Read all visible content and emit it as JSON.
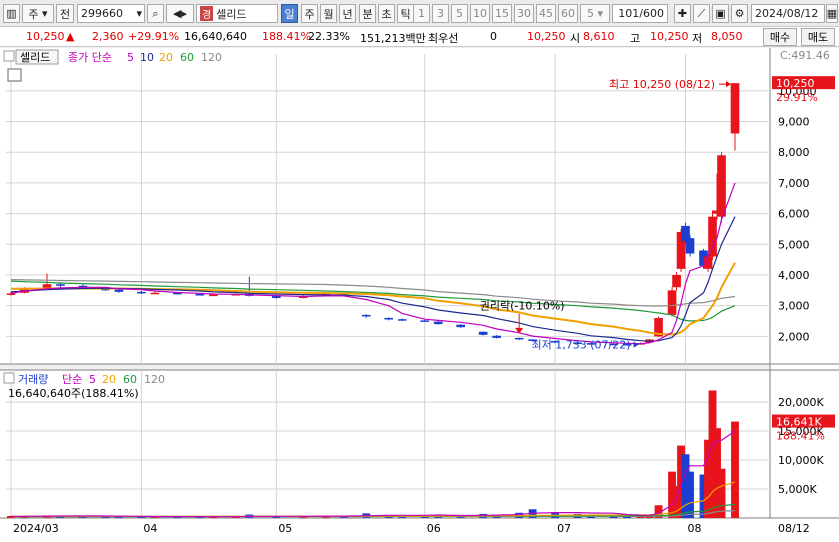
{
  "toolbar": {
    "market": "주",
    "all": "전",
    "code": "299660",
    "name_badge": "경",
    "name": "셀리드",
    "periods": [
      "일",
      "주",
      "월",
      "년",
      "분",
      "초",
      "틱"
    ],
    "minutes": [
      "1",
      "3",
      "5",
      "10",
      "15",
      "30",
      "45",
      "60"
    ],
    "interval": "5",
    "count": "101/600",
    "date": "2024/08/12"
  },
  "quote": {
    "price": "10,250",
    "change": "2,360",
    "change_pct": "+29.91%",
    "volume": "16,640,640",
    "volume_pct": "188.41%",
    "turnover": "22.33%",
    "amount": "151,213백만",
    "best_bid_label": "최우선",
    "best_bid": "0",
    "best_ask": "10,250",
    "open_label": "시",
    "open": "8,610",
    "high_label": "고",
    "high": "10,250",
    "low_label": "저",
    "low": "8,050",
    "buy": "매수",
    "sell": "매도"
  },
  "colors": {
    "up": "#e8141c",
    "down": "#1b3fd0",
    "ma5": "#c000c0",
    "ma10": "#1e2a8c",
    "ma20": "#f2a000",
    "ma60": "#1e9a3a",
    "ma120": "#8a8a8a"
  },
  "chart_data": [
    {
      "type": "candlestick",
      "panel_label": "셀리드",
      "indicator_label": "종가 단순",
      "ma_periods": [
        "5",
        "10",
        "20",
        "60",
        "120"
      ],
      "x_dates": [
        "2024/03/04",
        "2024/03/07",
        "2024/03/12",
        "2024/03/15",
        "2024/03/20",
        "2024/03/25",
        "2024/03/28",
        "2024/04/02",
        "2024/04/05",
        "2024/04/10",
        "2024/04/15",
        "2024/04/18",
        "2024/04/23",
        "2024/04/26",
        "2024/05/02",
        "2024/05/08",
        "2024/05/13",
        "2024/05/17",
        "2024/05/22",
        "2024/05/27",
        "2024/05/30",
        "2024/06/04",
        "2024/06/07",
        "2024/06/12",
        "2024/06/17",
        "2024/06/20",
        "2024/06/25",
        "2024/06/28",
        "2024/07/03",
        "2024/07/08",
        "2024/07/11",
        "2024/07/16",
        "2024/07/19",
        "2024/07/22",
        "2024/07/24",
        "2024/07/26",
        "2024/07/29",
        "2024/07/30",
        "2024/07/31",
        "2024/08/01",
        "2024/08/02",
        "2024/08/05",
        "2024/08/06",
        "2024/08/07",
        "2024/08/08",
        "2024/08/09",
        "2024/08/12"
      ],
      "close": [
        3400,
        3550,
        3700,
        3650,
        3600,
        3500,
        3450,
        3400,
        3420,
        3380,
        3350,
        3360,
        3380,
        3320,
        3250,
        3300,
        3400,
        3350,
        2650,
        2550,
        2520,
        2500,
        2400,
        2300,
        2050,
        1950,
        1900,
        1850,
        1800,
        1780,
        1760,
        1750,
        1740,
        1780,
        1900,
        2600,
        3500,
        4000,
        5400,
        5100,
        4700,
        4300,
        4600,
        5900,
        6100,
        7900,
        10250
      ],
      "open": [
        3350,
        3420,
        3580,
        3700,
        3650,
        3600,
        3520,
        3450,
        3400,
        3420,
        3380,
        3340,
        3360,
        3380,
        3320,
        3250,
        3320,
        3400,
        2700,
        2600,
        2560,
        2520,
        2480,
        2380,
        2150,
        2020,
        1950,
        1900,
        1850,
        1800,
        1780,
        1760,
        1750,
        1740,
        1800,
        2000,
        2700,
        3600,
        4200,
        5600,
        5200,
        4800,
        4200,
        4600,
        6000,
        5900,
        8610
      ],
      "high": [
        3450,
        3600,
        4050,
        3750,
        3700,
        3620,
        3550,
        3480,
        3460,
        3440,
        3400,
        3380,
        3400,
        3950,
        3340,
        3340,
        3430,
        3420,
        2720,
        2620,
        2580,
        2540,
        2500,
        2400,
        2160,
        2040,
        1960,
        1910,
        1860,
        1820,
        1800,
        1780,
        1770,
        1800,
        1920,
        2650,
        3600,
        4100,
        5500,
        5700,
        5300,
        4850,
        4700,
        6100,
        7300,
        8000,
        10250
      ],
      "low": [
        3330,
        3400,
        3550,
        3600,
        3580,
        3480,
        3420,
        3380,
        3380,
        3360,
        3330,
        3330,
        3340,
        3300,
        3230,
        3240,
        3300,
        3330,
        2600,
        2520,
        2500,
        2480,
        2380,
        2280,
        2030,
        1930,
        1880,
        1830,
        1780,
        1760,
        1740,
        1733,
        1735,
        1735,
        1780,
        1980,
        2650,
        3500,
        4100,
        5000,
        4600,
        4200,
        4100,
        4500,
        5800,
        5700,
        8050
      ],
      "ma5": [
        3400,
        3480,
        3550,
        3580,
        3600,
        3600,
        3550,
        3520,
        3480,
        3430,
        3400,
        3380,
        3370,
        3350,
        3330,
        3300,
        3320,
        3320,
        3200,
        3000,
        2750,
        2560,
        2520,
        2460,
        2360,
        2240,
        2120,
        2010,
        1930,
        1860,
        1820,
        1790,
        1770,
        1760,
        1790,
        1890,
        2130,
        2520,
        3080,
        3720,
        4140,
        4300,
        4620,
        4900,
        5200,
        5800,
        7000
      ],
      "ma10": [
        3450,
        3480,
        3520,
        3540,
        3560,
        3570,
        3560,
        3550,
        3530,
        3510,
        3480,
        3450,
        3430,
        3400,
        3380,
        3360,
        3350,
        3340,
        3300,
        3200,
        3080,
        2960,
        2860,
        2760,
        2680,
        2580,
        2440,
        2320,
        2200,
        2100,
        2020,
        1960,
        1900,
        1860,
        1840,
        1860,
        1960,
        2100,
        2340,
        2700,
        3100,
        3420,
        3760,
        4200,
        4600,
        5000,
        5900
      ],
      "ma20": [
        3550,
        3550,
        3560,
        3560,
        3560,
        3560,
        3560,
        3550,
        3540,
        3530,
        3520,
        3500,
        3480,
        3460,
        3440,
        3420,
        3410,
        3400,
        3380,
        3340,
        3300,
        3240,
        3160,
        3080,
        2980,
        2880,
        2780,
        2680,
        2580,
        2480,
        2400,
        2320,
        2240,
        2180,
        2120,
        2080,
        2060,
        2080,
        2140,
        2240,
        2400,
        2600,
        2800,
        3000,
        3250,
        3600,
        4400
      ],
      "ma60": [
        3800,
        3780,
        3760,
        3740,
        3720,
        3700,
        3680,
        3660,
        3640,
        3620,
        3600,
        3580,
        3560,
        3540,
        3520,
        3500,
        3480,
        3460,
        3430,
        3400,
        3360,
        3320,
        3280,
        3240,
        3200,
        3160,
        3120,
        3080,
        3040,
        3000,
        2960,
        2920,
        2880,
        2840,
        2800,
        2760,
        2700,
        2620,
        2560,
        2520,
        2500,
        2520,
        2560,
        2620,
        2720,
        2820,
        3000
      ],
      "ma120": [
        3850,
        3840,
        3830,
        3820,
        3810,
        3800,
        3790,
        3780,
        3770,
        3760,
        3750,
        3740,
        3730,
        3720,
        3710,
        3700,
        3690,
        3670,
        3640,
        3600,
        3560,
        3510,
        3460,
        3410,
        3360,
        3310,
        3260,
        3210,
        3160,
        3120,
        3080,
        3050,
        3020,
        3000,
        2990,
        2990,
        3000,
        3020,
        3040,
        3060,
        3080,
        3100,
        3130,
        3160,
        3200,
        3240,
        3300
      ],
      "y_ticks": [
        2000,
        3000,
        4000,
        5000,
        6000,
        7000,
        8000,
        9000,
        10000
      ],
      "y_tick_labels": [
        "2,000",
        "3,000",
        "4,000",
        "5,000",
        "6,000",
        "7,000",
        "8,000",
        "9,000",
        "10,000"
      ],
      "ylim": [
        1100,
        11200
      ],
      "x_tick_labels": [
        {
          "date": "2024/03/04",
          "label": "2024/03"
        },
        {
          "date": "2024/04/02",
          "label": "04"
        },
        {
          "date": "2024/05/02",
          "label": "05"
        },
        {
          "date": "2024/06/04",
          "label": "06"
        },
        {
          "date": "2024/07/03",
          "label": "07"
        },
        {
          "date": "2024/08/01",
          "label": "08"
        },
        {
          "date": "2024/08/12",
          "label": "08/12"
        }
      ],
      "price_tag": "10,250",
      "price_tag_pct": "29.91%",
      "top_label": "C:491.46",
      "annotations": [
        {
          "date": "2024/08/12",
          "value": 10250,
          "text": "최고 10,250 (08/12)",
          "color": "#e00000"
        },
        {
          "date": "2024/07/22",
          "value": 1733,
          "text": "최저 1,733 (07/22)",
          "color": "#1b3fd0"
        },
        {
          "date": "2024/06/25",
          "value": 3000,
          "text": "권리락(-10.10%)",
          "color": "#000000"
        }
      ]
    },
    {
      "type": "bar",
      "panel_label": "거래량",
      "indicator_label": "단순",
      "ma_periods": [
        "5",
        "20",
        "60",
        "120"
      ],
      "volume_readout": "16,640,640주(188.41%)",
      "values": [
        350000,
        300000,
        450000,
        420000,
        300000,
        250000,
        260000,
        240000,
        220000,
        230000,
        210000,
        200000,
        220000,
        600000,
        250000,
        230000,
        280000,
        300000,
        800000,
        500000,
        450000,
        420000,
        380000,
        400000,
        700000,
        600000,
        900000,
        1500000,
        1000000,
        700000,
        500000,
        450000,
        400000,
        380000,
        600000,
        2200000,
        8000000,
        5500000,
        12500000,
        11000000,
        8000000,
        7500000,
        13500000,
        22000000,
        15500000,
        8500000,
        16640640
      ],
      "vol_ma5": [
        300000,
        300000,
        320000,
        340000,
        360000,
        340000,
        330000,
        300000,
        260000,
        240000,
        230000,
        220000,
        220000,
        300000,
        300000,
        300000,
        320000,
        330000,
        400000,
        450000,
        460000,
        470000,
        510000,
        430000,
        470000,
        500000,
        600000,
        820000,
        940000,
        940000,
        860000,
        820000,
        610000,
        490000,
        470000,
        800000,
        2300000,
        3400000,
        5800000,
        7800000,
        9000000,
        9000000,
        10500000,
        12500000,
        13300000,
        13400000,
        15000000
      ],
      "vol_ma20": [
        280000,
        290000,
        300000,
        300000,
        300000,
        300000,
        300000,
        300000,
        300000,
        295000,
        290000,
        285000,
        280000,
        290000,
        290000,
        290000,
        290000,
        290000,
        310000,
        320000,
        330000,
        335000,
        340000,
        345000,
        360000,
        375000,
        400000,
        450000,
        480000,
        500000,
        510000,
        520000,
        530000,
        540000,
        550000,
        620000,
        920000,
        1150000,
        1720000,
        2250000,
        2600000,
        2950000,
        3550000,
        4500000,
        5150000,
        5500000,
        6200000
      ],
      "vol_ma60": [
        250000,
        252000,
        254000,
        256000,
        258000,
        260000,
        262000,
        264000,
        266000,
        268000,
        270000,
        272000,
        274000,
        276000,
        278000,
        280000,
        282000,
        284000,
        290000,
        295000,
        300000,
        305000,
        310000,
        315000,
        320000,
        325000,
        330000,
        340000,
        350000,
        355000,
        360000,
        365000,
        370000,
        375000,
        380000,
        400000,
        500000,
        580000,
        750000,
        900000,
        1050000,
        1150000,
        1350000,
        1700000,
        1950000,
        2100000,
        2350000
      ],
      "vol_ma120": [
        230000,
        231000,
        232000,
        233000,
        234000,
        235000,
        236000,
        237000,
        238000,
        239000,
        240000,
        241000,
        242000,
        243000,
        244000,
        245000,
        246000,
        247000,
        250000,
        252000,
        254000,
        256000,
        258000,
        260000,
        262000,
        264000,
        266000,
        270000,
        274000,
        276000,
        278000,
        280000,
        282000,
        284000,
        286000,
        296000,
        346000,
        386000,
        470000,
        550000,
        620000,
        680000,
        780000,
        950000,
        1080000,
        1150000,
        1280000
      ],
      "y_ticks": [
        5000000,
        10000000,
        15000000,
        20000000
      ],
      "y_tick_labels": [
        "5,000K",
        "10,000K",
        "15,000K",
        "20,000K"
      ],
      "ylim": [
        0,
        24500000
      ],
      "value_tag": "16,641K",
      "value_tag_pct": "188.41%"
    }
  ]
}
